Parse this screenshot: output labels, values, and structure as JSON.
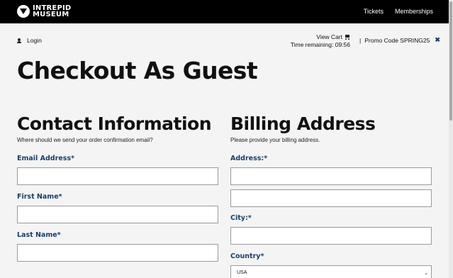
{
  "header": {
    "logo_line1": "INTREPID",
    "logo_line2": "MUSEUM",
    "nav": [
      "Tickets",
      "Memberships"
    ]
  },
  "account": {
    "login_label": "Login"
  },
  "cart": {
    "view_cart_label": "View Cart",
    "time_remaining_label": "Time remaining:",
    "time_remaining_value": "09:56"
  },
  "promo": {
    "separator": "|",
    "label": "Promo Code SPRING25",
    "remove_icon": "close-icon"
  },
  "page": {
    "title": "Checkout As Guest"
  },
  "contact": {
    "title": "Contact Information",
    "subtitle": "Where should we send your order confirmation email?",
    "fields": [
      {
        "label": "Email Address*",
        "value": ""
      },
      {
        "label": "First Name*",
        "value": ""
      },
      {
        "label": "Last Name*",
        "value": ""
      }
    ]
  },
  "billing": {
    "title": "Billing Address",
    "subtitle": "Please provide your billing address.",
    "address_label": "Address:*",
    "address_line1": "",
    "address_line2": "",
    "city_label": "City:*",
    "city_value": "",
    "country_label": "Country*",
    "country_value": "USA"
  },
  "colors": {
    "accent": "#1a3f66",
    "topbar": "#000000",
    "background": "#f4f4f4"
  }
}
